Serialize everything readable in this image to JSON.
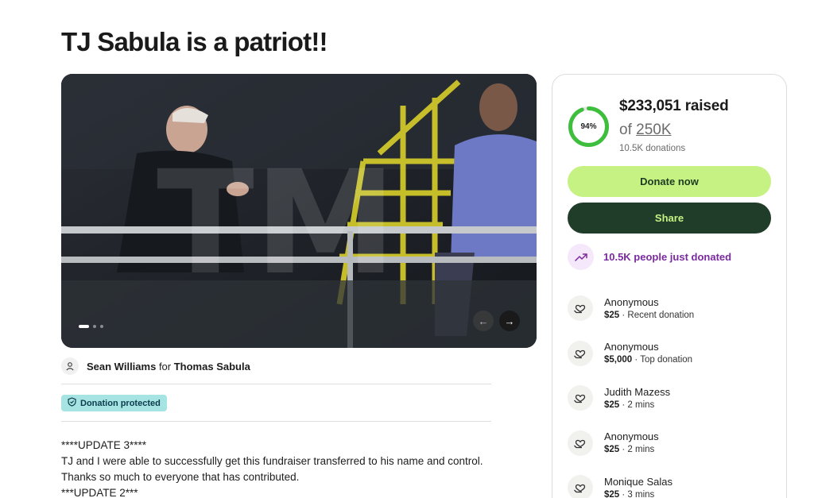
{
  "title": "TJ Sabula is a patriot!!",
  "organizer": {
    "name": "Sean Williams",
    "connector": "for",
    "beneficiary": "Thomas Sabula"
  },
  "badge": {
    "label": "Donation protected",
    "icon": "shield-icon"
  },
  "story": {
    "lines": [
      "****UPDATE 3****",
      "TJ and I were able to successfully get this fundraiser transferred to his name and control.",
      "Thanks so much to everyone that has contributed.",
      "***UPDATE 2***"
    ]
  },
  "media": {
    "watermark": "TMZ",
    "slides_total": 3,
    "active_slide": 1
  },
  "progress": {
    "percent_label": "94%",
    "percent": 0.94,
    "raised": "$233,051 raised",
    "goal_prefix": "of",
    "goal_amount": "250K",
    "donations_count": "10.5K donations"
  },
  "buttons": {
    "donate": "Donate now",
    "share": "Share"
  },
  "trend": {
    "text": "10.5K people just donated",
    "icon": "trending-up-icon"
  },
  "donations": [
    {
      "name": "Anonymous",
      "amount": "$25",
      "note": "Recent donation"
    },
    {
      "name": "Anonymous",
      "amount": "$5,000",
      "note": "Top donation"
    },
    {
      "name": "Judith Mazess",
      "amount": "$25",
      "note": "2 mins"
    },
    {
      "name": "Anonymous",
      "amount": "$25",
      "note": "2 mins"
    },
    {
      "name": "Monique Salas",
      "amount": "$25",
      "note": "3 mins"
    }
  ],
  "colors": {
    "accent_green": "#c5f283",
    "dark_green": "#1f3d29",
    "progress_green": "#3dbe3d",
    "trend_purple": "#7a2a9e",
    "badge_teal": "#a6e3e3"
  }
}
